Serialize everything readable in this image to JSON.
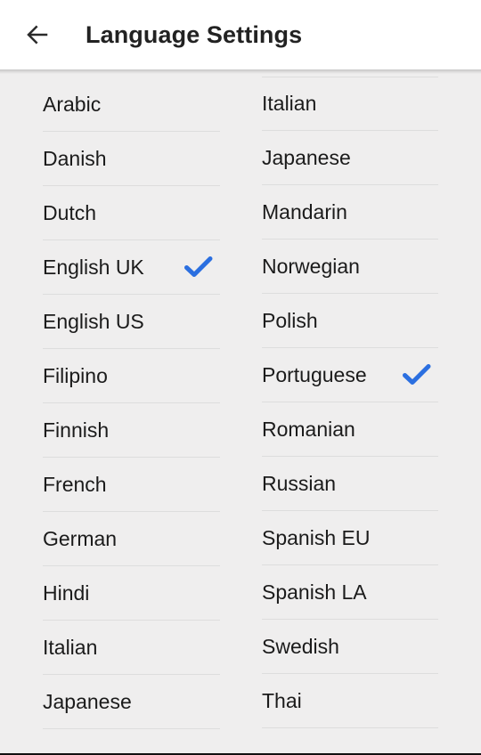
{
  "header": {
    "back_icon": "arrow-left-icon",
    "title": "Language Settings"
  },
  "accent_color": "#2b6fe0",
  "background_color": "#efeeee",
  "appbar_color": "#ffffff",
  "divider_color": "#dddddd",
  "text_color": "#1b1b1b",
  "check_icon": "check-icon",
  "columns": {
    "left": [
      {
        "label": "Arabic",
        "selected": false
      },
      {
        "label": "Danish",
        "selected": false
      },
      {
        "label": "Dutch",
        "selected": false
      },
      {
        "label": "English UK",
        "selected": true
      },
      {
        "label": "English US",
        "selected": false
      },
      {
        "label": "Filipino",
        "selected": false
      },
      {
        "label": "Finnish",
        "selected": false
      },
      {
        "label": "French",
        "selected": false
      },
      {
        "label": "German",
        "selected": false
      },
      {
        "label": "Hindi",
        "selected": false
      },
      {
        "label": "Italian",
        "selected": false
      },
      {
        "label": "Japanese",
        "selected": false
      }
    ],
    "right": [
      {
        "label": "Italian",
        "selected": false
      },
      {
        "label": "Japanese",
        "selected": false
      },
      {
        "label": "Mandarin",
        "selected": false
      },
      {
        "label": "Norwegian",
        "selected": false
      },
      {
        "label": "Polish",
        "selected": false
      },
      {
        "label": "Portuguese",
        "selected": true
      },
      {
        "label": "Romanian",
        "selected": false
      },
      {
        "label": "Russian",
        "selected": false
      },
      {
        "label": "Spanish EU",
        "selected": false
      },
      {
        "label": "Spanish LA",
        "selected": false
      },
      {
        "label": "Swedish",
        "selected": false
      },
      {
        "label": "Thai",
        "selected": false
      }
    ]
  }
}
